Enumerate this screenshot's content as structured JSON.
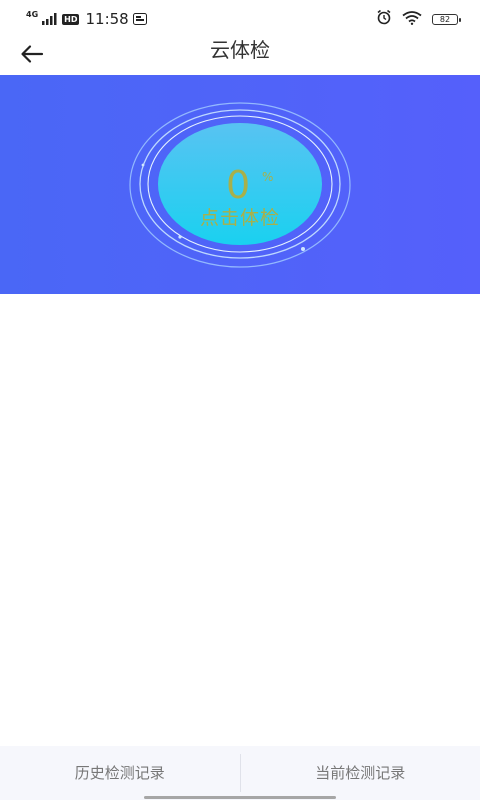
{
  "status_bar": {
    "network_type": "4G",
    "hd_label": "HD",
    "time": "11:58",
    "battery": "82"
  },
  "header": {
    "title": "云体检"
  },
  "checkup": {
    "percent": "0",
    "percent_unit": "%",
    "action_label": "点击体检"
  },
  "tabs": [
    {
      "label": "历史检测记录"
    },
    {
      "label": "当前检测记录"
    }
  ],
  "colors": {
    "hero_gradient_start": "#4a67f6",
    "hero_gradient_end": "#5560fb",
    "gauge_fill": "#1ad1f0",
    "percent_text": "#a8b04a"
  }
}
